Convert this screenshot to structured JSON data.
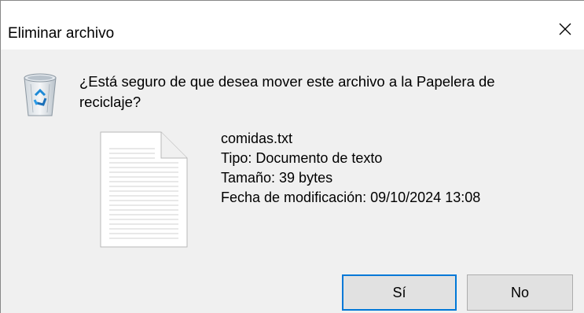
{
  "window": {
    "title": "Eliminar archivo",
    "close_icon": "close-icon"
  },
  "message": {
    "icon": "recycle-bin-icon",
    "text": "¿Está seguro de que desea mover este archivo a la Papelera de reciclaje?"
  },
  "file": {
    "icon": "text-file-icon",
    "name": "comidas.txt",
    "type": "Tipo: Documento de texto",
    "size": "Tamaño: 39 bytes",
    "modified": "Fecha de modificación: 09/10/2024 13:08"
  },
  "buttons": {
    "yes_label": "Sí",
    "no_label": "No"
  },
  "colors": {
    "focus_border": "#0078d7",
    "button_bg": "#e1e1e1",
    "dialog_bg": "#f0f0f0"
  }
}
